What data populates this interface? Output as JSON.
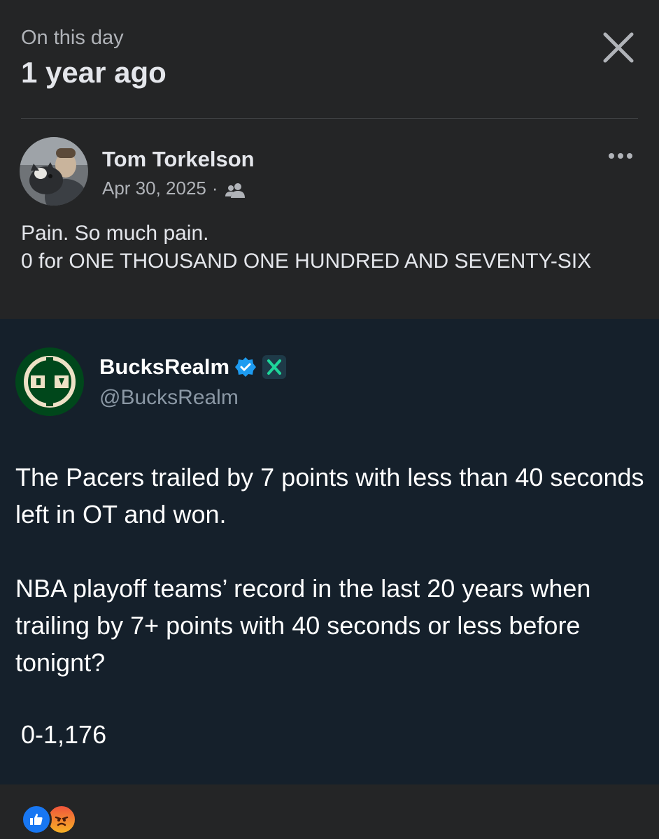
{
  "memory": {
    "kicker": "On this day",
    "title": "1 year ago",
    "close_icon": "close-icon"
  },
  "post": {
    "author": "Tom Torkelson",
    "date": "Apr 30, 2025",
    "separator": "·",
    "audience_icon": "friends-icon",
    "more_icon": "more-horizontal-icon",
    "text_line_1": "Pain. So much pain.",
    "text_line_2": "0 for ONE THOUSAND ONE HUNDRED AND SEVENTY-SIX"
  },
  "tweet": {
    "name": "BucksRealm",
    "handle": "@BucksRealm",
    "verified_icon": "verified-badge-icon",
    "x_icon": "x-logo-icon",
    "paragraph_1": "The Pacers trailed by 7 points with less than 40 seconds left in OT and won.",
    "paragraph_2": "NBA playoff teams’ record in the last 20 years when trailing by 7+ points with 40 seconds or less before tonignt?",
    "stat": "0-1,176",
    "accent_green": "#00471b",
    "verified_blue": "#1d9bf0"
  },
  "reactions": {
    "items": [
      "like-reaction-icon",
      "angry-reaction-icon"
    ]
  }
}
